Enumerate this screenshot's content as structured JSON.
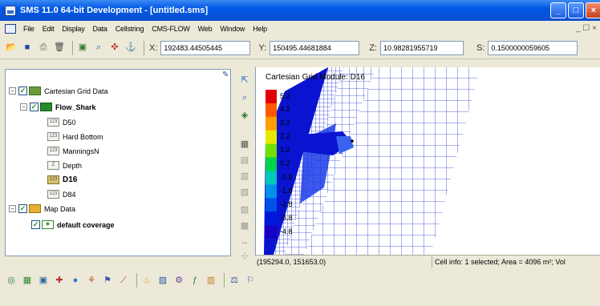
{
  "window": {
    "title": "SMS 11.0 64-bit Development - [untitled.sms]",
    "minimize": "_",
    "maximize": "□",
    "close": "×"
  },
  "menu": [
    "File",
    "Edit",
    "Display",
    "Data",
    "Cellstring",
    "CMS-FLOW",
    "Web",
    "Window",
    "Help"
  ],
  "mdi_controls": "_ ☐ ×",
  "toolbar": {
    "x_label": "X:",
    "x_value": "192483.44505445",
    "y_label": "Y:",
    "y_value": "150495.44681884",
    "z_label": "Z:",
    "z_value": "10.98281955719",
    "s_label": "S:",
    "s_value": "0.1500000059605"
  },
  "tree": {
    "root": "Cartesian Grid Data",
    "grid": "Flow_Shark",
    "datasets": [
      "D50",
      "Hard Bottom",
      "ManningsN",
      "Depth",
      "D16",
      "D84"
    ],
    "dataset_badges": [
      "123",
      "123",
      "123",
      "Z",
      "123",
      "123"
    ],
    "active_dataset": "D16",
    "map_root": "Map Data",
    "coverage": "default coverage"
  },
  "legend": {
    "title": "Cartesian Grid Module: D16",
    "ticks": [
      "5.2",
      "4.2",
      "3.2",
      "2.2",
      "1.2",
      "0.2",
      "-0.8",
      "-1.8",
      "-2.8",
      "-3.8",
      "-4.8"
    ],
    "colors": [
      "#e00000",
      "#ff5a00",
      "#ff9e00",
      "#e8e800",
      "#6fe000",
      "#00d24a",
      "#00c8b8",
      "#0090e8",
      "#0050e8",
      "#0018d8",
      "#1800c0"
    ]
  },
  "status": {
    "cursor": "(195294.0, 151653.0)",
    "cell_info": "Cell info: 1 selected; Area = 4096 m²; Vol"
  },
  "colors": {
    "titlebar": "#0058e6",
    "grid_line": "#2a3ad8",
    "water_dark": "#0a14d0"
  }
}
